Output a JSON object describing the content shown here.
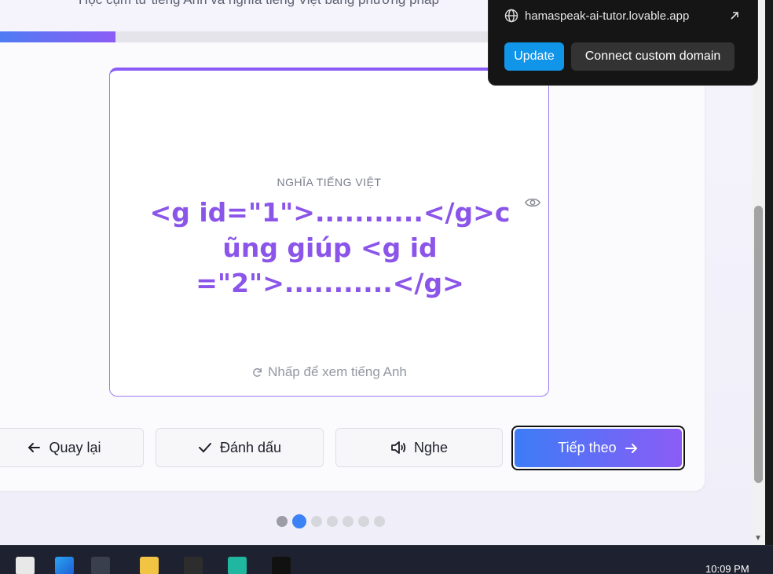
{
  "page": {
    "subtitle": "Học cụm từ tiếng Anh và nghĩa tiếng Việt bằng phương pháp",
    "progress_fraction": 0.23
  },
  "card": {
    "label": "NGHĨA TIẾNG VIỆT",
    "text": "<g id=\"1\">...........</g>cũng giúp <g id=\"2\">...........</g>",
    "hint": "Nhấp để xem tiếng Anh"
  },
  "actions": {
    "back": "Quay lại",
    "mark": "Đánh dấu",
    "listen": "Nghe",
    "next": "Tiếp theo"
  },
  "pagination": {
    "total": 7,
    "current": 2
  },
  "popup": {
    "url": "hamaspeak-ai-tutor.lovable.app",
    "update": "Update",
    "connect_domain": "Connect custom domain"
  },
  "taskbar": {
    "time": "10:09 PM"
  },
  "colors": {
    "accent": "#8b5cf6",
    "primary": "#3b82f6",
    "update": "#1095e8"
  }
}
